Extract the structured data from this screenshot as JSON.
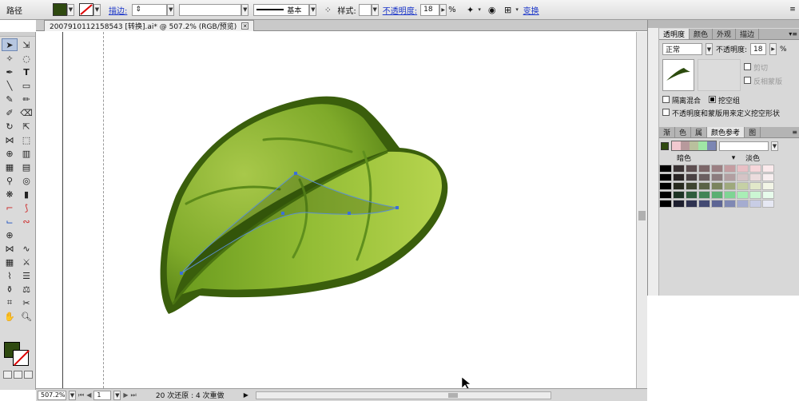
{
  "control_bar": {
    "object_type": "路径",
    "fill_color": "#2f4a10",
    "stroke_label": "描边:",
    "brush_label": "基本",
    "style_label": "样式:",
    "opacity_label": "不透明度:",
    "opacity_value": "18",
    "opacity_unit": "%",
    "transform_label": "变换"
  },
  "document": {
    "tab_title": "2007910112158543 [转换].ai* @ 507.2% (RGB/预览)"
  },
  "status_bar": {
    "zoom": "507.2%",
    "artboard": "1",
    "history": "20 次还原 : 4 次重做"
  },
  "transparency_panel": {
    "tabs": [
      "透明度",
      "颜色",
      "外观",
      "描边"
    ],
    "blend_mode": "正常",
    "opacity_label": "不透明度:",
    "opacity_value": "18",
    "opacity_unit": "%",
    "clip_label": "剪切",
    "invert_label": "反相蒙版",
    "isolate_label": "隔离混合",
    "knockout_label": "挖空组",
    "define_label": "不透明度和蒙版用来定义挖空形状"
  },
  "guide_panel": {
    "tabs": [
      "渐",
      "色",
      "属",
      "颜色参考",
      "图"
    ],
    "darker_label": "暗色",
    "lighter_label": "淡色",
    "harmony": [
      "#f1c8cf",
      "#b7999c",
      "#b9c09d",
      "#9fe6a5",
      "#7c86b3"
    ],
    "rows": [
      [
        "#000000",
        "#3b3334",
        "#5e4f51",
        "#7c6668",
        "#9b7f82",
        "#c49da1",
        "#e8c0c5",
        "#f6d6da",
        "#fbeaec"
      ],
      [
        "#000000",
        "#2a2626",
        "#4a4244",
        "#6b5f60",
        "#8c7c7e",
        "#b29fa1",
        "#d5c4c6",
        "#ebdcdd",
        "#f7eeef"
      ],
      [
        "#000000",
        "#272a1f",
        "#3e4430",
        "#5a6246",
        "#7a845e",
        "#9ea97d",
        "#c5d0a5",
        "#e1e8c9",
        "#f2f5e6"
      ],
      [
        "#000000",
        "#1d3324",
        "#2f5c3b",
        "#428455",
        "#5aaf72",
        "#7fd494",
        "#a9eeb6",
        "#cbf6d3",
        "#e7fbeb"
      ],
      [
        "#000000",
        "#1d1f2e",
        "#2f3350",
        "#434a73",
        "#5d6594",
        "#7f88b3",
        "#a5acd0",
        "#c8cde5",
        "#e6e8f3"
      ]
    ]
  }
}
